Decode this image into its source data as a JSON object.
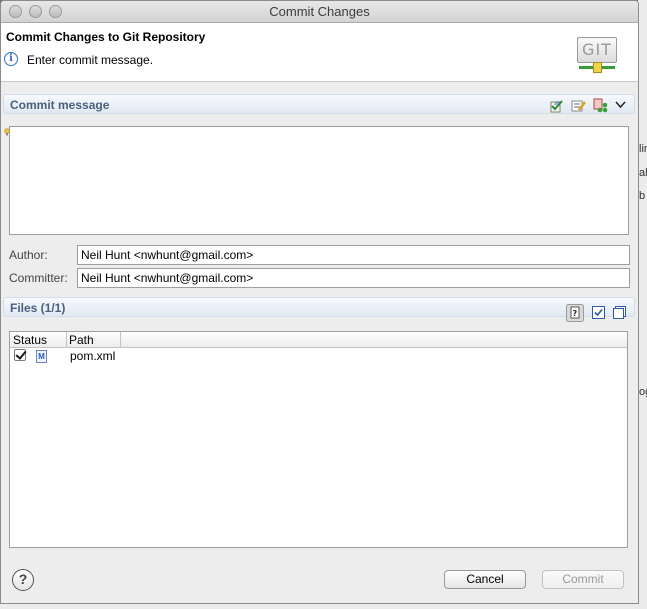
{
  "window": {
    "title": "Commit Changes"
  },
  "header": {
    "title": "Commit Changes to Git Repository",
    "message": "Enter commit message.",
    "logo_text": "GIT"
  },
  "commit_message": {
    "section_title": "Commit message",
    "value": ""
  },
  "author": {
    "label": "Author:",
    "value": "Neil Hunt <nwhunt@gmail.com>"
  },
  "committer": {
    "label": "Committer:",
    "value": "Neil Hunt <nwhunt@gmail.com>"
  },
  "files": {
    "section_title": "Files (1/1)",
    "columns": [
      "Status",
      "Path"
    ],
    "rows": [
      {
        "checked": true,
        "status_icon": "maven-file-icon",
        "status_glyph": "M",
        "path": "pom.xml"
      }
    ]
  },
  "buttons": {
    "cancel": "Cancel",
    "commit": "Commit"
  },
  "background_fragments": [
    "lin",
    "al",
    "b",
    "og"
  ],
  "colors": {
    "section_title": "#4b5f7a",
    "git_rail": "#3a9a3a",
    "info": "#2f6fc0"
  }
}
